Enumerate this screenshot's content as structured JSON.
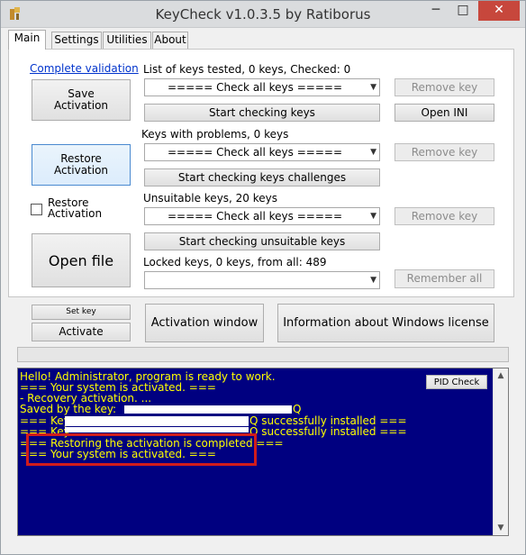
{
  "window": {
    "title": "KeyCheck v1.0.3.5 by Ratiborus",
    "minimize": "─",
    "maximize": "□",
    "close": "✕"
  },
  "tabs": [
    "Main",
    "Settings",
    "Utilities",
    "About"
  ],
  "left": {
    "complete_validation": "Complete validation",
    "save_activation": "Save\nActivation",
    "restore_activation": "Restore\nActivation",
    "restore_checkbox_label": "Restore\nActivation",
    "open_file": "Open file"
  },
  "sections": [
    {
      "label": "List of keys tested, 0 keys,  Checked: 0",
      "select": "===== Check all keys =====",
      "action": "Start checking keys",
      "side": "Remove key",
      "side2": "Open INI"
    },
    {
      "label": "Keys with problems, 0 keys",
      "select": "===== Check all keys =====",
      "action": "Start checking keys challenges",
      "side": "Remove key"
    },
    {
      "label": "Unsuitable keys, 20 keys",
      "select": "===== Check all keys =====",
      "action": "Start checking unsuitable keys",
      "side": "Remove key"
    },
    {
      "label": "Locked keys, 0 keys, from all: 489",
      "select": "",
      "side": "Remember all"
    }
  ],
  "bottom": {
    "set_key": "Set key",
    "activate": "Activate",
    "activation_window": "Activation window",
    "info_license": "Information about Windows license"
  },
  "console": {
    "pid_check": "PID Check",
    "lines": [
      "Hello! Administrator, program is ready to work.",
      "=== Your system is activated. ===",
      "- Recovery activation. ...",
      "Saved by the key:",
      "=== Key",
      "=== Key",
      "=== Restoring the activation is completed ===",
      "=== Your system is activated. ==="
    ],
    "key_suffix_1": "Q successfully installed ===",
    "key_suffix_2": "Q successfully installed ===",
    "saved_key_tail": "Q"
  },
  "colors": {
    "console_bg": "#000080",
    "console_text": "#ffff00",
    "highlight": "#d01c1c"
  }
}
